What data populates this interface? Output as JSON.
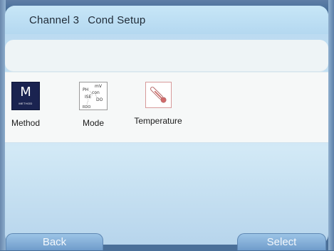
{
  "header": {
    "channel": "Channel 3",
    "title": "Cond Setup"
  },
  "icons": [
    {
      "name": "method",
      "label": "Method",
      "glyph": "M",
      "caption": "METHOD"
    },
    {
      "name": "mode",
      "label": "Mode",
      "parts": [
        "PH",
        "mV",
        "con",
        "ISE",
        "DO",
        "RDO"
      ]
    },
    {
      "name": "temperature",
      "label": "Temperature",
      "icon": "thermometer-icon"
    }
  ],
  "buttons": {
    "back": "Back",
    "select": "Select"
  },
  "colors": {
    "method_tile": "#1a2350",
    "temperature_border": "#d79a9a",
    "button": "#86b0d9"
  }
}
